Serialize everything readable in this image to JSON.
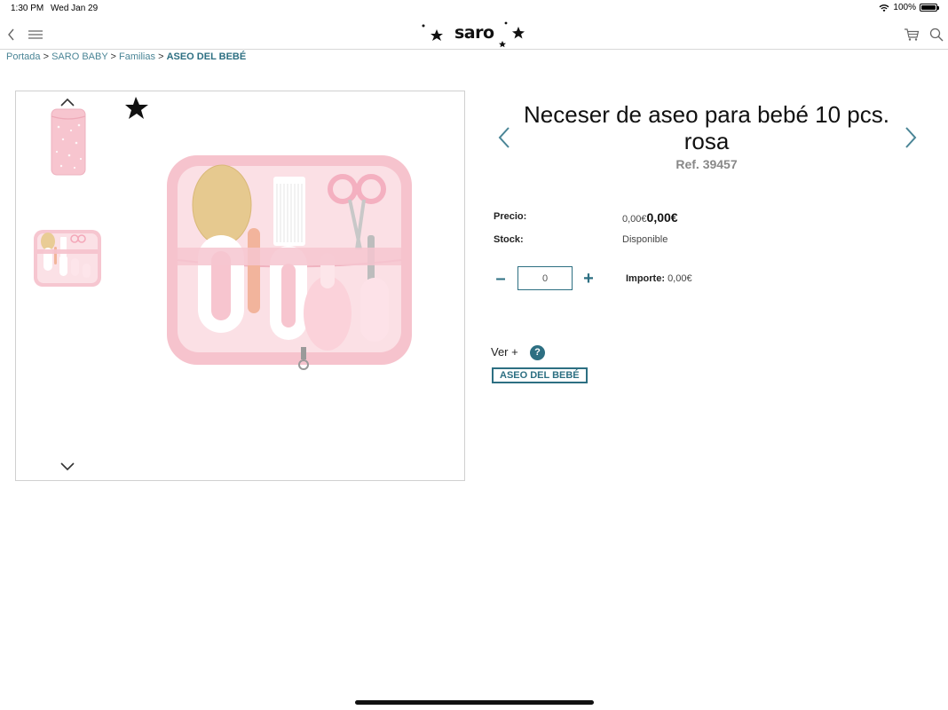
{
  "status_bar": {
    "time": "1:30 PM",
    "date": "Wed Jan 29",
    "battery": "100%",
    "battery_level": 1.0
  },
  "header": {
    "logo_text": "saro",
    "icons": [
      "back-icon",
      "menu-icon",
      "cart-icon",
      "search-icon"
    ]
  },
  "breadcrumb": {
    "items": [
      "Portada",
      "SARO BABY",
      "Familias"
    ],
    "separator": ">",
    "current": "ASEO DEL BEBÉ"
  },
  "product": {
    "title": "Neceser de aseo para bebé 10 pcs. rosa",
    "ref": "Ref. 39457",
    "price_label": "Precio:",
    "price_old": "0,00€",
    "price_new": "0,00€",
    "stock_label": "Stock:",
    "stock_value": "Disponible",
    "quantity": "0",
    "minus": "–",
    "plus": "+",
    "importe_label": "Importe:",
    "importe_value": "0,00€",
    "ver_mas": "Ver +",
    "help": "?",
    "tag": "ASEO DEL BEBÉ"
  },
  "colors": {
    "accent": "#2d6f82",
    "link": "#4a8596",
    "product_pink": "#f6c9d1"
  }
}
